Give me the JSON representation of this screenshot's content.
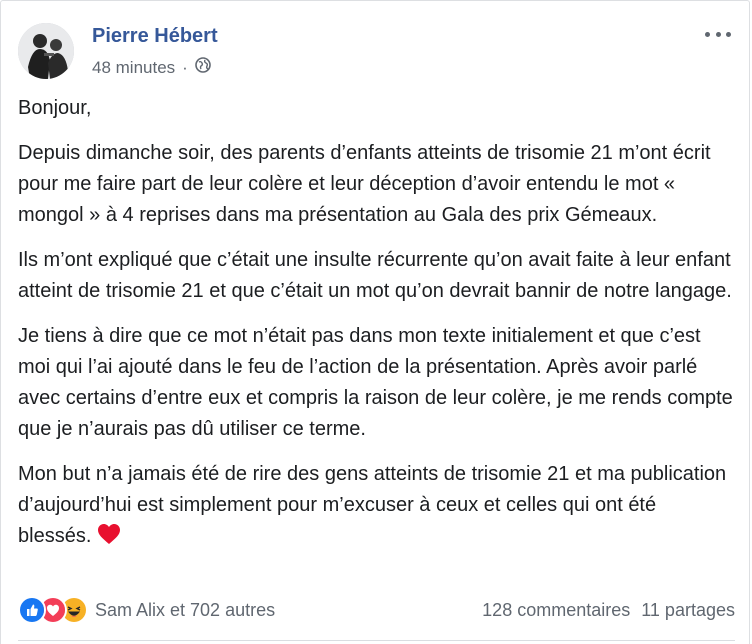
{
  "post": {
    "author": "Pierre Hébert",
    "timestamp": "48 minutes",
    "separator": "·",
    "privacy_icon": "globe-icon",
    "paragraphs": [
      "Bonjour,",
      "Depuis dimanche soir, des parents d’enfants atteints de trisomie 21 m’ont écrit pour me faire part de leur colère et leur déception d’avoir entendu le mot « mongol » à 4 reprises dans ma présentation au Gala des prix Gémeaux.",
      "Ils m’ont expliqué que c’était une insulte récurrente qu’on avait faite à leur enfant atteint de trisomie 21 et que c’était un mot qu’on devrait bannir de notre langage.",
      "Je tiens à dire que ce mot n’était pas dans mon texte initialement et que c’est moi qui l’ai ajouté dans le feu de l’action de la présentation. Après avoir parlé avec certains d’entre eux et compris la raison de leur colère, je me rends compte que je n’aurais pas dû utiliser ce terme.",
      "Mon but n’a jamais été de rire des gens atteints de trisomie 21 et ma publication d’aujourd’hui est simplement pour m’excuser à ceux et celles qui ont été blessés."
    ],
    "end_emoji": "heart-emoji"
  },
  "footer": {
    "reaction_icons": [
      "like-icon",
      "love-icon",
      "haha-icon"
    ],
    "reaction_names": "Sam Alix et 702 autres",
    "comments": "128 commentaires",
    "shares": "11 partages"
  },
  "colors": {
    "author_link": "#365899",
    "meta_text": "#606770",
    "like_blue": "#1877f2",
    "love_red": "#f33e58",
    "haha_yellow": "#f7b125"
  }
}
